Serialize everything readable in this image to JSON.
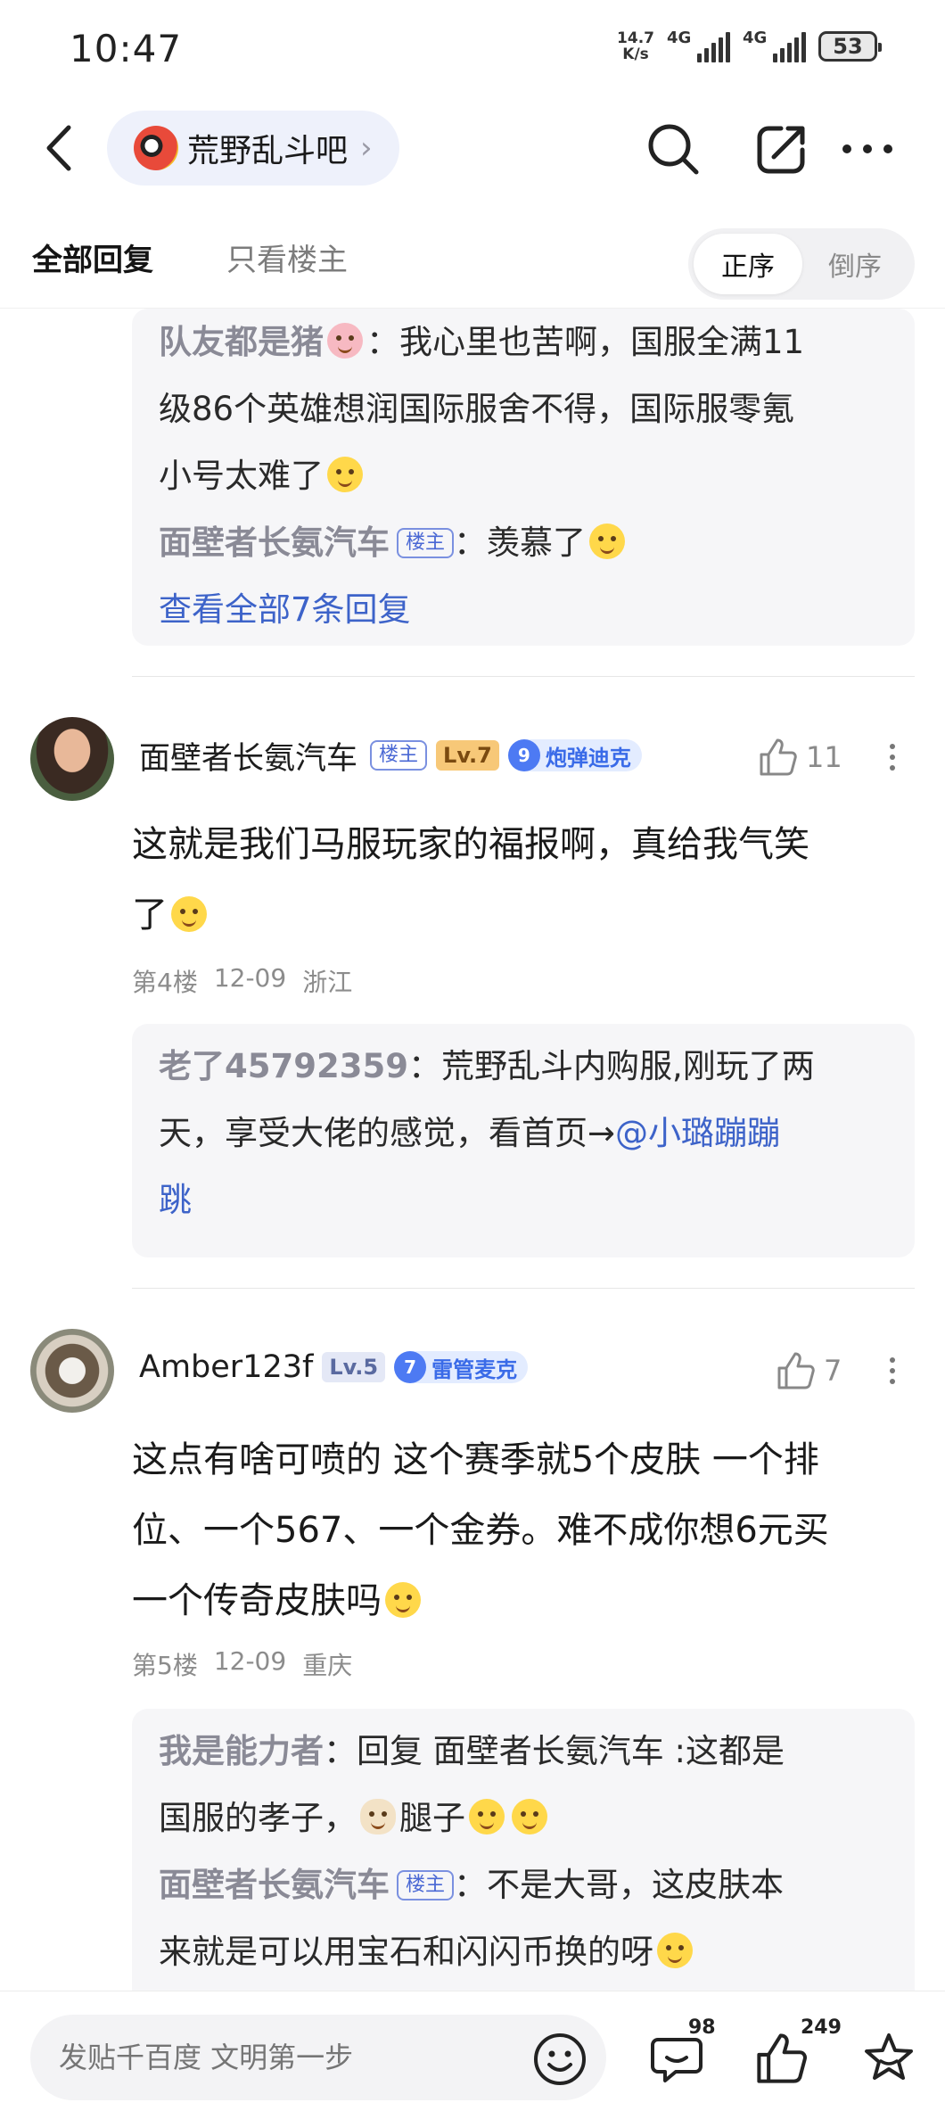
{
  "status_bar": {
    "time": "10:47",
    "net_speed_value": "14.7",
    "net_speed_unit": "K/s",
    "sim1_label": "4G",
    "sim2_label": "4G",
    "battery": "53"
  },
  "nav": {
    "forum_name": "荒野乱斗吧",
    "forum_chevron": "›"
  },
  "tabs": {
    "all_replies": "全部回复",
    "owner_only": "只看楼主",
    "sort_asc": "正序",
    "sort_desc": "倒序"
  },
  "top_reply_box": {
    "line1_user": "队友都是猪",
    "line1_text_a": "：我心里也苦啊，国服全满11",
    "line1_text_b": "级86个英雄想润国际服舍不得，国际服零氪",
    "line1_text_c": "小号太难了",
    "line2_user": "面壁者长氨汽车",
    "line2_tag": "楼主",
    "line2_text": "：羡慕了",
    "more_replies": "查看全部7条回复"
  },
  "comments": [
    {
      "name": "面壁者长氨汽车",
      "owner_tag": "楼主",
      "level": "Lv.7",
      "fan_level": "9",
      "fan_name": "炮弹迪克",
      "likes": "11",
      "body_a": "这就是我们马服玩家的福报啊，真给我气笑",
      "body_b": "了",
      "floor": "第4楼",
      "date": "12-09",
      "location": "浙江",
      "reply": {
        "user": "老了45792359",
        "text_a": "：荒野乱斗内购服,刚玩了两",
        "text_b": "天，享受大佬的感觉，看首页→",
        "mention_a": "@小璐蹦蹦",
        "mention_b": "跳"
      }
    },
    {
      "name": "Amber123f",
      "level": "Lv.5",
      "fan_level": "7",
      "fan_name": "雷管麦克",
      "likes": "7",
      "body_a": "这点有啥可喷的 这个赛季就5个皮肤 一个排",
      "body_b": "位、一个567、一个金券。难不成你想6元买",
      "body_c": "一个传奇皮肤吗",
      "floor": "第5楼",
      "date": "12-09",
      "location": "重庆",
      "reply": {
        "line1_user": "我是能力者",
        "line1_text_a": "：回复 面壁者长氨汽车 :这都是",
        "line1_text_b": "国服的孝子，",
        "line1_text_c": "腿子",
        "line2_user": "面壁者长氨汽车",
        "line2_tag": "楼主",
        "line2_text_a": "：不是大哥，这皮肤本",
        "line2_text_b": "来就是可以用宝石和闪闪币换的呀"
      }
    }
  ],
  "bottom_bar": {
    "input_placeholder": "发贴千百度 文明第一步",
    "comment_count": "98",
    "like_count": "249"
  },
  "colors": {
    "link_blue": "#3d63c9",
    "reply_bg": "#f6f6f8",
    "fan_badge_blue": "#4d7af3"
  }
}
